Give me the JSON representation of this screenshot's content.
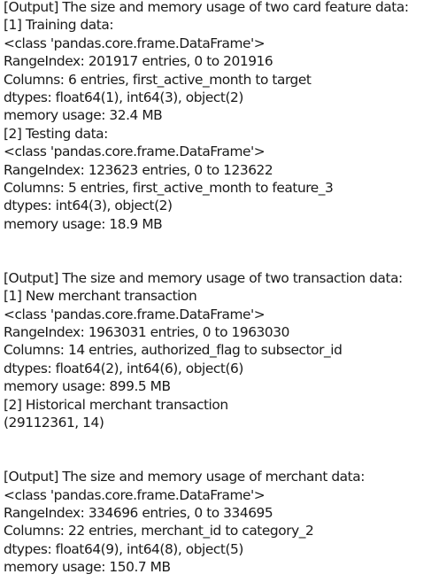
{
  "sections": [
    {
      "lines": [
        "[Output] The size and memory usage of two card feature data:",
        "[1] Training data:",
        "<class 'pandas.core.frame.DataFrame'>",
        "RangeIndex: 201917 entries, 0 to 201916",
        "Columns: 6 entries, first_active_month to target",
        "dtypes: float64(1), int64(3), object(2)",
        "memory usage: 32.4 MB",
        "[2] Testing data:",
        "<class 'pandas.core.frame.DataFrame'>",
        "RangeIndex: 123623 entries, 0 to 123622",
        "Columns: 5 entries, first_active_month to feature_3",
        "dtypes: int64(3), object(2)",
        "memory usage: 18.9 MB"
      ]
    },
    {
      "lines": [
        "[Output] The size and memory usage of two transaction data:",
        "[1] New merchant transaction",
        "<class 'pandas.core.frame.DataFrame'>",
        "RangeIndex: 1963031 entries, 0 to 1963030",
        "Columns: 14 entries, authorized_flag to subsector_id",
        "dtypes: float64(2), int64(6), object(6)",
        "memory usage: 899.5 MB",
        "[2] Historical merchant transaction",
        "(29112361, 14)"
      ]
    },
    {
      "lines": [
        "[Output] The size and memory usage of merchant data:",
        "<class 'pandas.core.frame.DataFrame'>",
        "RangeIndex: 334696 entries, 0 to 334695",
        "Columns: 22 entries, merchant_id to category_2",
        "dtypes: float64(9), int64(8), object(5)",
        "memory usage: 150.7 MB"
      ]
    }
  ]
}
